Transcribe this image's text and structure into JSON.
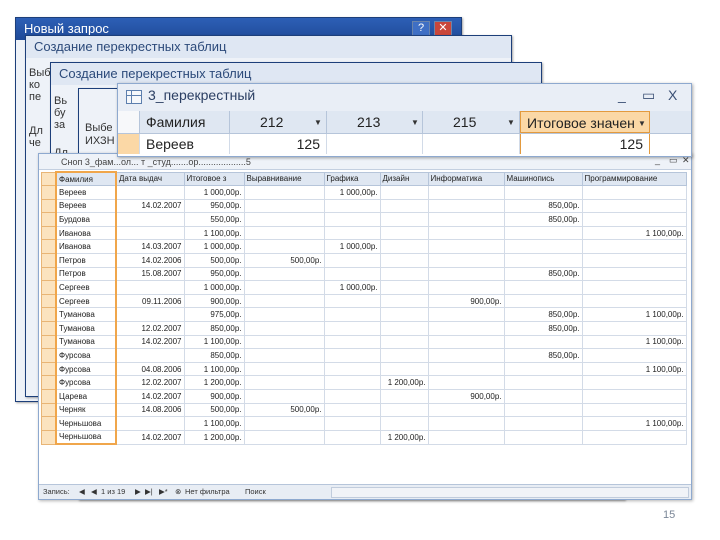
{
  "windows": {
    "main_title": "Новый запрос",
    "wizard1_title": "Создание перекрестных таблиц",
    "wizard2_title": "Создание перекрестных таблиц",
    "wizard1_frags": [
      "Выб",
      "ко",
      "пе",
      "Дл",
      "че"
    ],
    "wizard2_frags": [
      "Вь",
      "бу",
      "за",
      "Дл"
    ],
    "wizard3_frags": [
      "Выбе",
      "ИХЗН"
    ]
  },
  "query": {
    "title": "3_перекрестный",
    "controls": {
      "minimize": "_",
      "restore": "▭",
      "close": "X"
    },
    "columns": [
      "Фамилия",
      "212",
      "213",
      "215",
      "Итоговое значен"
    ],
    "row": {
      "name": "Вереев",
      "v212": "125",
      "v213": "",
      "v215": "",
      "total": "125"
    }
  },
  "table": {
    "title": "Сноп 3_фам...ол... т _студ.......ор...................5",
    "columns": [
      "Фамилия",
      "Дата выдач",
      "Итоговое з",
      "Выравнивание",
      "Графика",
      "Дизайн",
      "Информатика",
      "Машинопись",
      "Программирование"
    ],
    "rows": [
      [
        "Вереев",
        "",
        "1 000,00р.",
        "",
        "1 000,00р.",
        "",
        "",
        "",
        ""
      ],
      [
        "Вереев",
        "14.02.2007",
        "950,00р.",
        "",
        "",
        "",
        "",
        "850,00р.",
        ""
      ],
      [
        "Бурдова",
        "",
        "550,00р.",
        "",
        "",
        "",
        "",
        "850,00р.",
        ""
      ],
      [
        "Иванова",
        "",
        "1 100,00р.",
        "",
        "",
        "",
        "",
        "",
        "1 100,00р."
      ],
      [
        "Иванова",
        "14.03.2007",
        "1 000,00р.",
        "",
        "1 000,00р.",
        "",
        "",
        "",
        ""
      ],
      [
        "Петров",
        "14.02.2006",
        "500,00р.",
        "500,00р.",
        "",
        "",
        "",
        "",
        ""
      ],
      [
        "Петров",
        "15.08.2007",
        "950,00р.",
        "",
        "",
        "",
        "",
        "850,00р.",
        ""
      ],
      [
        "Сергеев",
        "",
        "1 000,00р.",
        "",
        "1 000,00р.",
        "",
        "",
        "",
        ""
      ],
      [
        "Сергеев",
        "09.11.2006",
        "900,00р.",
        "",
        "",
        "",
        "900,00р.",
        "",
        ""
      ],
      [
        "Туманова",
        "",
        "975,00р.",
        "",
        "",
        "",
        "",
        "850,00р.",
        "1 100,00р."
      ],
      [
        "Туманова",
        "12.02.2007",
        "850,00р.",
        "",
        "",
        "",
        "",
        "850,00р.",
        ""
      ],
      [
        "Туманова",
        "14.02.2007",
        "1 100,00р.",
        "",
        "",
        "",
        "",
        "",
        "1 100,00р."
      ],
      [
        "Фурсова",
        "",
        "850,00р.",
        "",
        "",
        "",
        "",
        "850,00р.",
        ""
      ],
      [
        "Фурсова",
        "04.08.2006",
        "1 100,00р.",
        "",
        "",
        "",
        "",
        "",
        "1 100,00р."
      ],
      [
        "Фурсова",
        "12.02.2007",
        "1 200,00р.",
        "",
        "",
        "1 200,00р.",
        "",
        "",
        ""
      ],
      [
        "Царева",
        "14.02.2007",
        "900,00р.",
        "",
        "",
        "",
        "900,00р.",
        "",
        ""
      ],
      [
        "Черняк",
        "14.08.2006",
        "500,00р.",
        "500,00р.",
        "",
        "",
        "",
        "",
        ""
      ],
      [
        "Черньшова",
        "",
        "1 100,00р.",
        "",
        "",
        "",
        "",
        "",
        "1 100,00р."
      ],
      [
        "Черньшова",
        "14.02.2007",
        "1 200,00р.",
        "",
        "",
        "1 200,00р.",
        "",
        "",
        ""
      ]
    ],
    "nav": {
      "record_label": "Запись:",
      "record_pos": "1 из 19",
      "filter": "Нет фильтра",
      "search": "Поиск"
    }
  },
  "page_number": "15"
}
